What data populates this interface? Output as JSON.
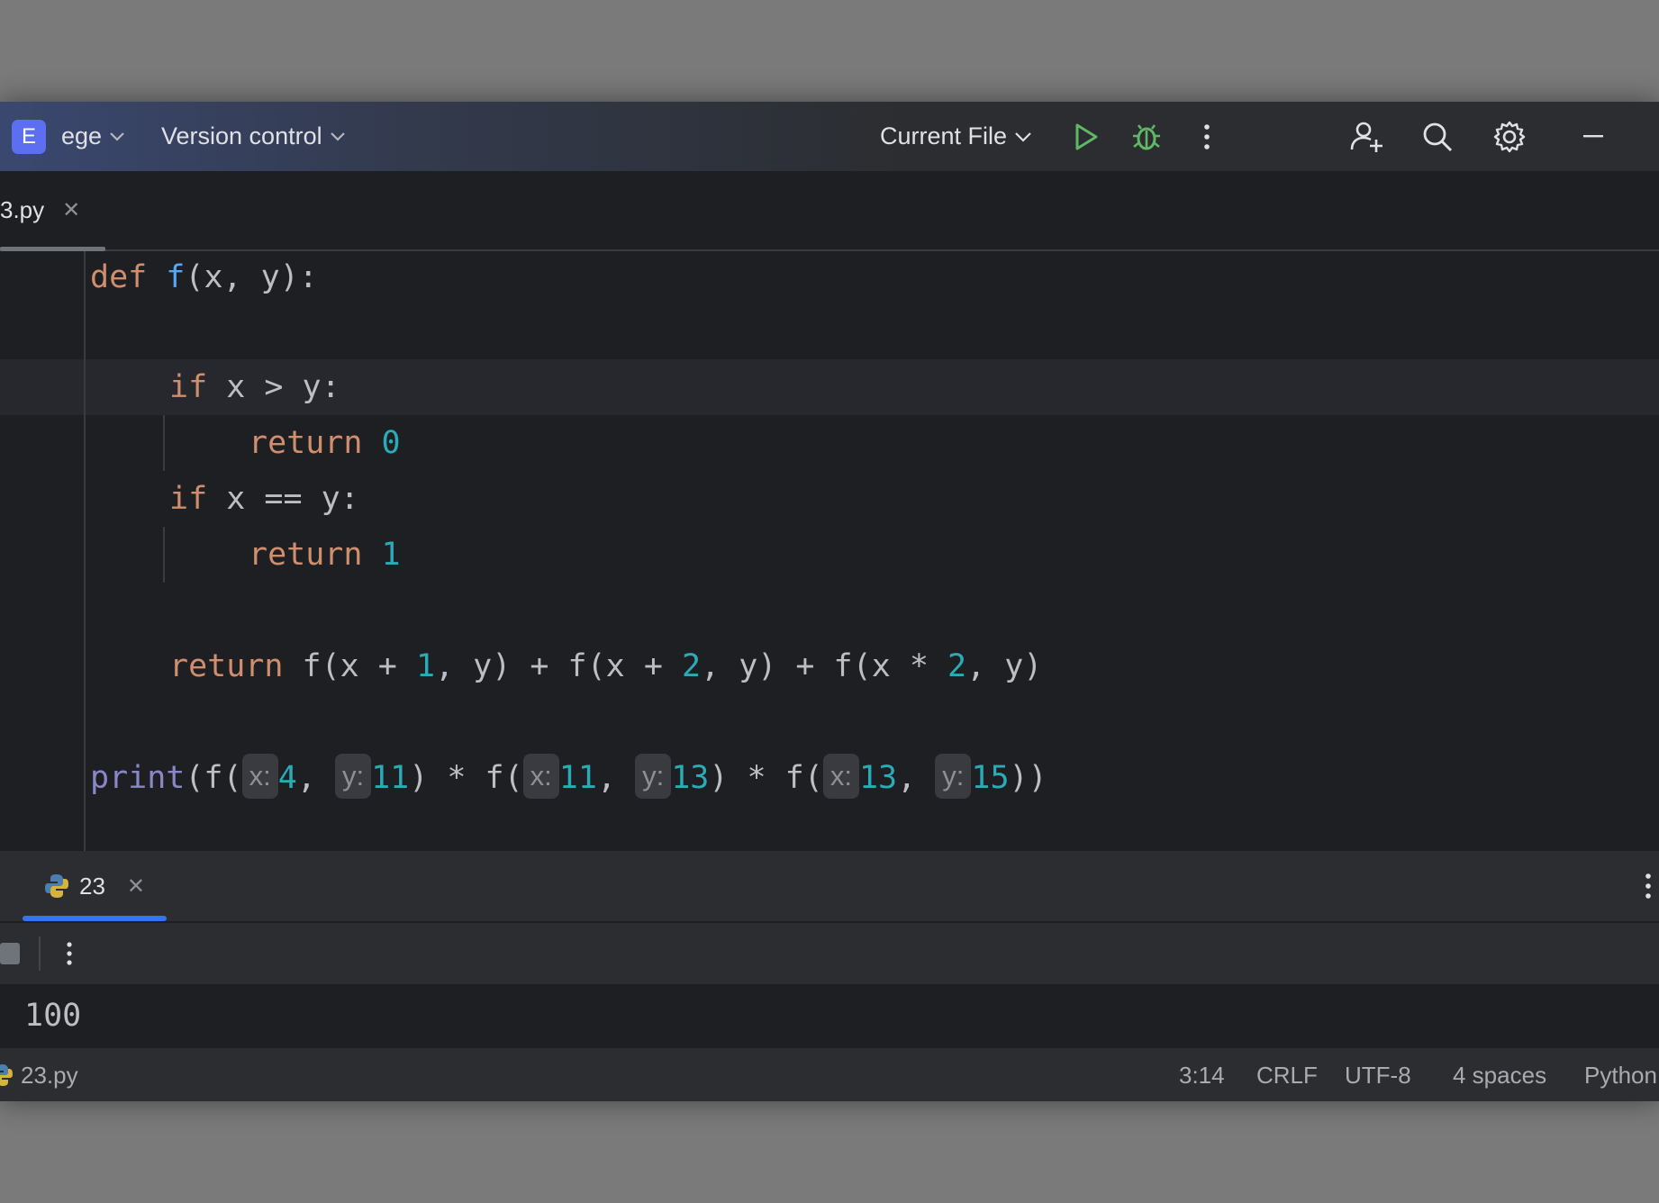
{
  "toolbar": {
    "project_initial": "E",
    "project_name": "ege",
    "vcs_label": "Version control",
    "run_config": "Current File"
  },
  "editor_tab": {
    "filename": "3.py"
  },
  "code": {
    "l1": {
      "kw": "def",
      "fn": "f",
      "rest": "(x, y):"
    },
    "l3": {
      "kw": "if",
      "rest": " x > y:"
    },
    "l4": {
      "kw": "return",
      "num": "0"
    },
    "l5": {
      "kw": "if",
      "rest": " x == y:"
    },
    "l6": {
      "kw": "return",
      "num": "1"
    },
    "l8": {
      "kw": "return",
      "p1": " f(x + ",
      "n1": "1",
      "p2": ", y) + f(x + ",
      "n2": "2",
      "p3": ", y) + f(x * ",
      "n3": "2",
      "p4": ", y)"
    },
    "l10": {
      "bi": "print",
      "p1": "(f(",
      "h1": "x:",
      "n1": "4",
      "p2": ", ",
      "h2": "y:",
      "n2": "11",
      "p3": ") * f(",
      "h3": "x:",
      "n3": "11",
      "p4": ", ",
      "h4": "y:",
      "n4": "13",
      "p5": ") * f(",
      "h5": "x:",
      "n5": "13",
      "p6": ", ",
      "h6": "y:",
      "n6": "15",
      "p7": "))"
    }
  },
  "run_panel": {
    "tab_label": "23",
    "output": "100"
  },
  "statusbar": {
    "file": "23.py",
    "position": "3:14",
    "line_sep": "CRLF",
    "encoding": "UTF-8",
    "indent": "4 spaces",
    "interpreter": "Python"
  },
  "colors": {
    "keyword": "#cf8e6d",
    "function": "#56a8f5",
    "number": "#2aacb8",
    "builtin": "#8888c6",
    "accent": "#3574f0",
    "run_green": "#5fb865"
  }
}
